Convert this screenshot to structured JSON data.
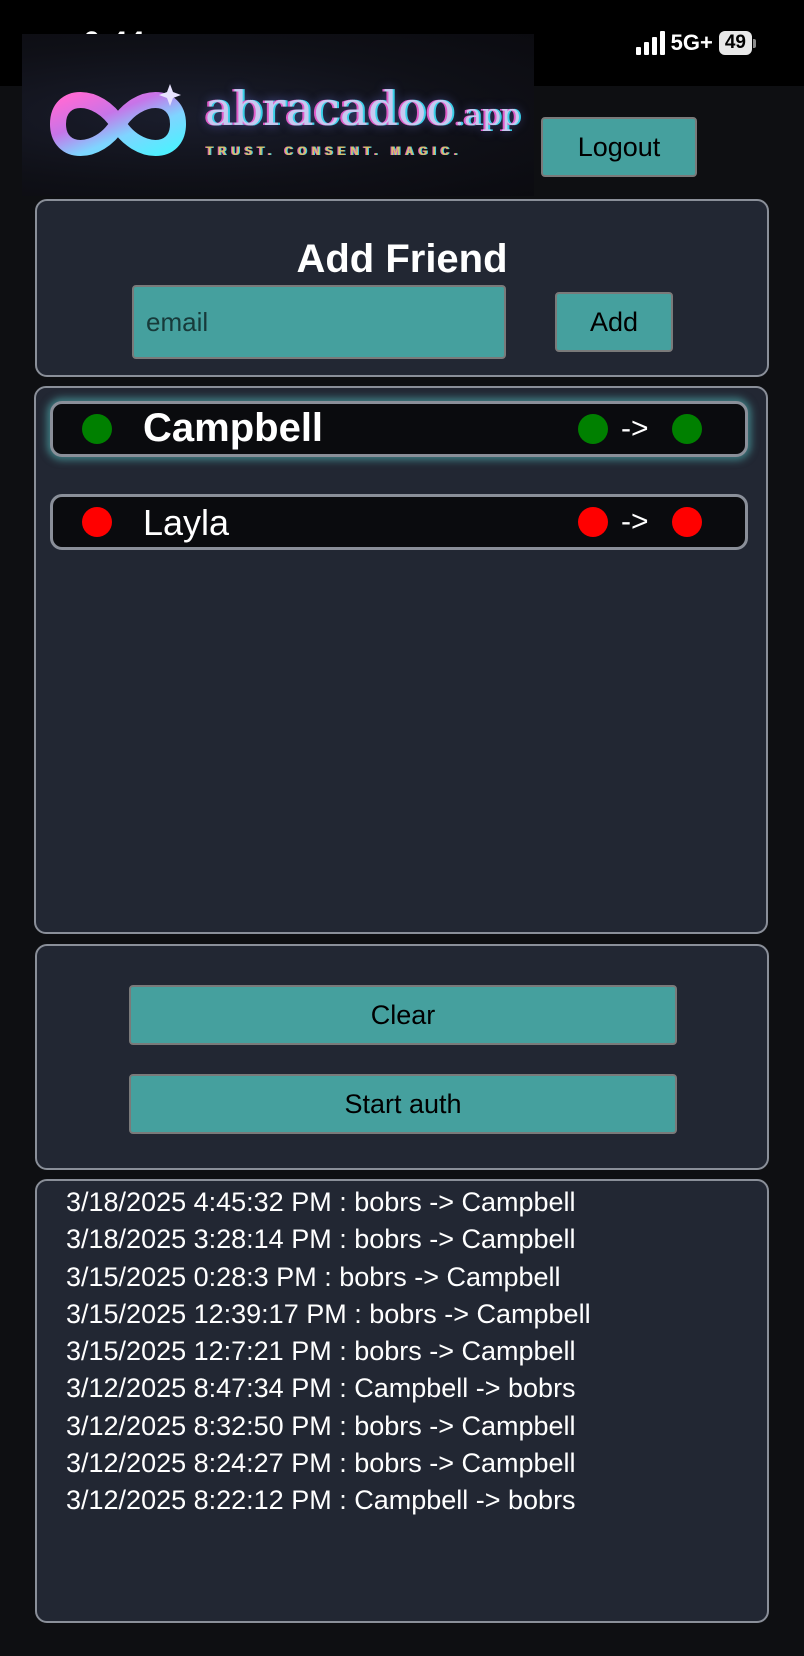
{
  "status_bar": {
    "time": "6:44",
    "network": "5G+",
    "battery": "49"
  },
  "brand": {
    "name": "abracadoo",
    "tld": ".app",
    "tagline": "TRUST. CONSENT. MAGIC."
  },
  "header": {
    "logout_label": "Logout"
  },
  "add_friend": {
    "title": "Add Friend",
    "email_placeholder": "email",
    "email_value": "",
    "add_label": "Add"
  },
  "friends": [
    {
      "name": "Campbell",
      "status_color": "#008000",
      "from_color": "#008000",
      "to_color": "#008000",
      "arrow": "->",
      "selected": true
    },
    {
      "name": "Layla",
      "status_color": "#ff0000",
      "from_color": "#ff0000",
      "to_color": "#ff0000",
      "arrow": "->",
      "selected": false
    }
  ],
  "actions": {
    "clear_label": "Clear",
    "start_auth_label": "Start auth"
  },
  "log": [
    "3/18/2025 4:45:32 PM : bobrs -> Campbell",
    "3/18/2025 3:28:14 PM : bobrs -> Campbell",
    "3/15/2025 0:28:3 PM : bobrs -> Campbell",
    "3/15/2025 12:39:17 PM : bobrs -> Campbell",
    "3/15/2025 12:7:21 PM : bobrs -> Campbell",
    "3/12/2025 8:47:34 PM : Campbell -> bobrs",
    "3/12/2025 8:32:50 PM : bobrs -> Campbell",
    "3/12/2025 8:24:27 PM : bobrs -> Campbell",
    "3/12/2025 8:22:12 PM : Campbell -> bobrs"
  ],
  "colors": {
    "accent_teal": "#45a09e",
    "panel_bg": "#222733",
    "page_bg": "#0e0f12"
  },
  "icons": {
    "logo": "infinity-icon",
    "signal": "signal-bars-icon",
    "battery": "battery-icon"
  }
}
